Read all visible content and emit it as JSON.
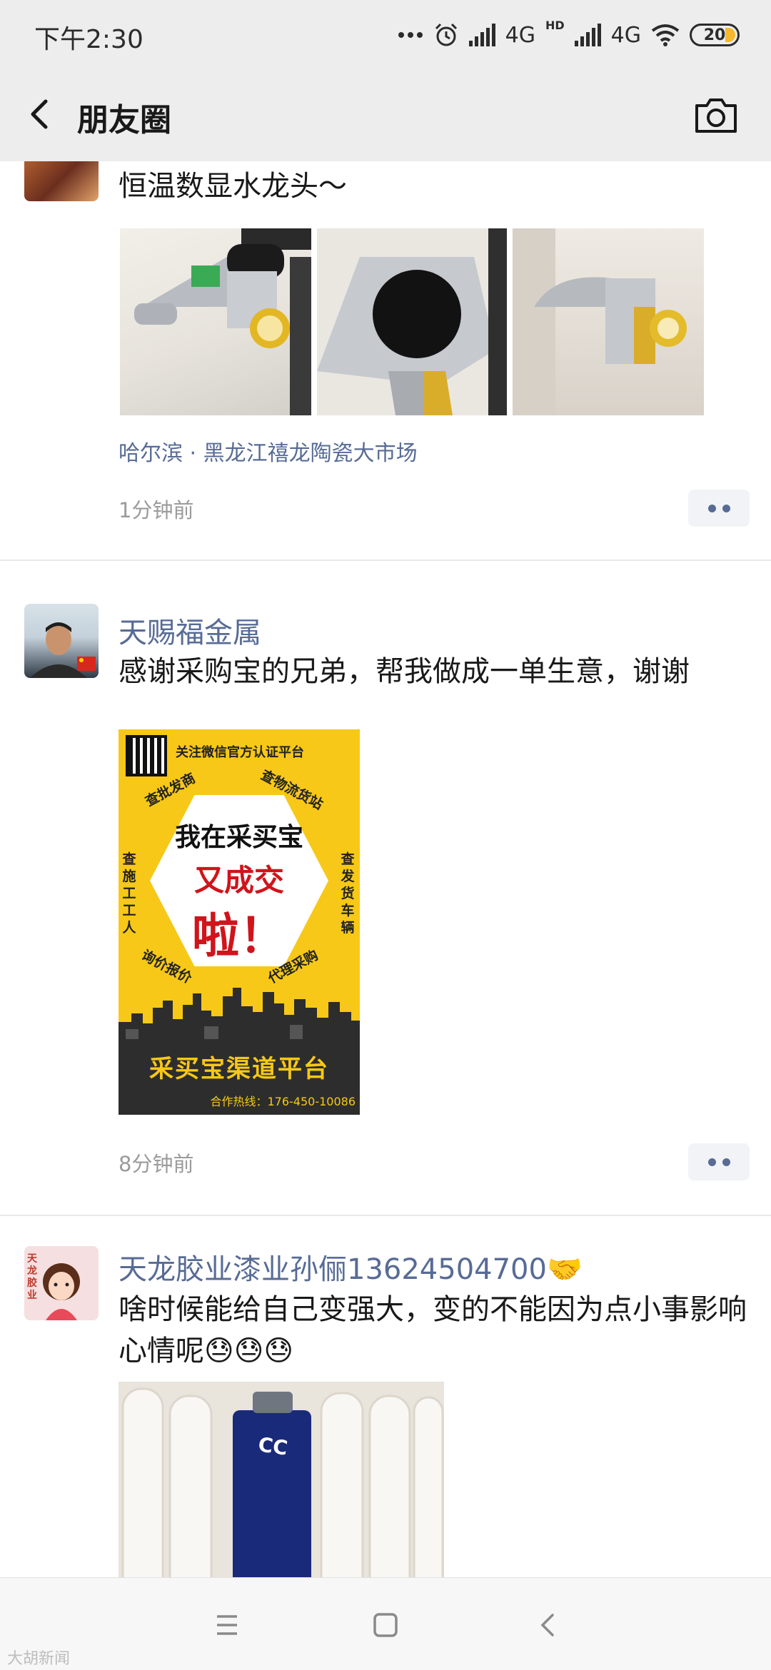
{
  "status": {
    "time": "下午2:30",
    "net1": "4G",
    "net1_sub": "HD",
    "net2": "4G",
    "battery": "20",
    "battery_level_percent": 20,
    "icons": [
      "more-dots-icon",
      "alarm-icon",
      "signal-icon",
      "signal-icon",
      "wifi-icon",
      "battery-icon"
    ]
  },
  "header": {
    "title": "朋友圈",
    "back_icon": "chevron-left-icon",
    "camera_icon": "camera-icon"
  },
  "posts": [
    {
      "text": "恒温数显水龙头～",
      "location": "哈尔滨 · 黑龙江禧龙陶瓷大市场",
      "time": "1分钟前",
      "images": [
        "faucet-photo-1",
        "faucet-photo-2",
        "faucet-photo-3"
      ]
    },
    {
      "nickname": "天赐福金属",
      "text": "感谢采购宝的兄弟，帮我做成一单生意，谢谢",
      "poster": {
        "top_text": "关注微信官方认证平台",
        "tag_left_top": "查批发商",
        "tag_right_top": "查物流货站",
        "tag_left_side": "查施工工人",
        "tag_right_side": "查发货车辆",
        "tag_left_bottom": "询价报价",
        "tag_right_bottom": "代理采购",
        "line1": "我在采买宝",
        "line2": "又成交",
        "line3": "啦！",
        "bottom_main": "采买宝渠道平台",
        "bottom_sub": "合作热线：176-450-10086"
      },
      "time": "8分钟前"
    },
    {
      "nickname": "天龙胶业漆业孙俪13624504700🤝",
      "text": "啥时候能给自己变强大，变的不能因为点小事影响心情呢😓😓😓",
      "avatar_text": "天龙胶业",
      "images": [
        "foam-sealant-photo"
      ]
    }
  ],
  "navbar": {
    "icons": [
      "menu-icon",
      "home-icon",
      "back-icon"
    ]
  },
  "watermark": "大胡新闻"
}
